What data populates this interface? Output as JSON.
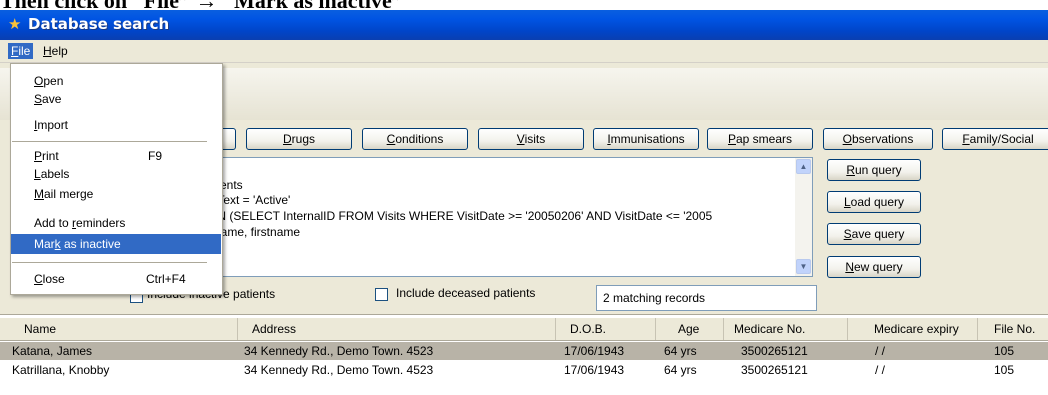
{
  "caption": "Then click on “File” → “Mark as inactive”",
  "window": {
    "title": "Database search"
  },
  "menubar": {
    "file": "File",
    "help": "Help"
  },
  "file_menu": {
    "items": [
      {
        "label": "Open"
      },
      {
        "label": "Save"
      },
      {
        "label": "Import"
      },
      {
        "label": "Print",
        "shortcut": "F9"
      },
      {
        "label": "Labels"
      },
      {
        "label": "Mail merge"
      },
      {
        "label": "Add to reminders"
      },
      {
        "label": "Mark as inactive"
      },
      {
        "label": "Close",
        "shortcut": "Ctrl+F4"
      }
    ]
  },
  "tabs": [
    "Drugs",
    "Conditions",
    "Visits",
    "Immunisations",
    "Pap smears",
    "Observations",
    "Family/Social"
  ],
  "query": {
    "lines": [
      "tients",
      ":Text = 'Active'",
      "IN (SELECT InternalID FROM Visits WHERE VisitDate >= '20050206' AND VisitDate <= '2005",
      "name, firstname"
    ]
  },
  "query_buttons": {
    "run": "Run query",
    "load": "Load query",
    "save": "Save query",
    "new": "New query"
  },
  "options": {
    "include_inactive": "Include inactive patients",
    "include_deceased": "Include deceased patients"
  },
  "records": "2 matching records",
  "grid": {
    "columns": [
      "Name",
      "Address",
      "D.O.B.",
      "Age",
      "Medicare No.",
      "Medicare expiry",
      "File No."
    ],
    "rows": [
      [
        "Katana, James",
        "34 Kennedy Rd., Demo Town. 4523",
        "17/06/1943",
        "64 yrs",
        "3500265121",
        "/ /",
        "105"
      ],
      [
        "Katrillana, Knobby",
        "34 Kennedy Rd., Demo Town. 4523",
        "17/06/1943",
        "64 yrs",
        "3500265121",
        "/ /",
        "105"
      ]
    ]
  }
}
